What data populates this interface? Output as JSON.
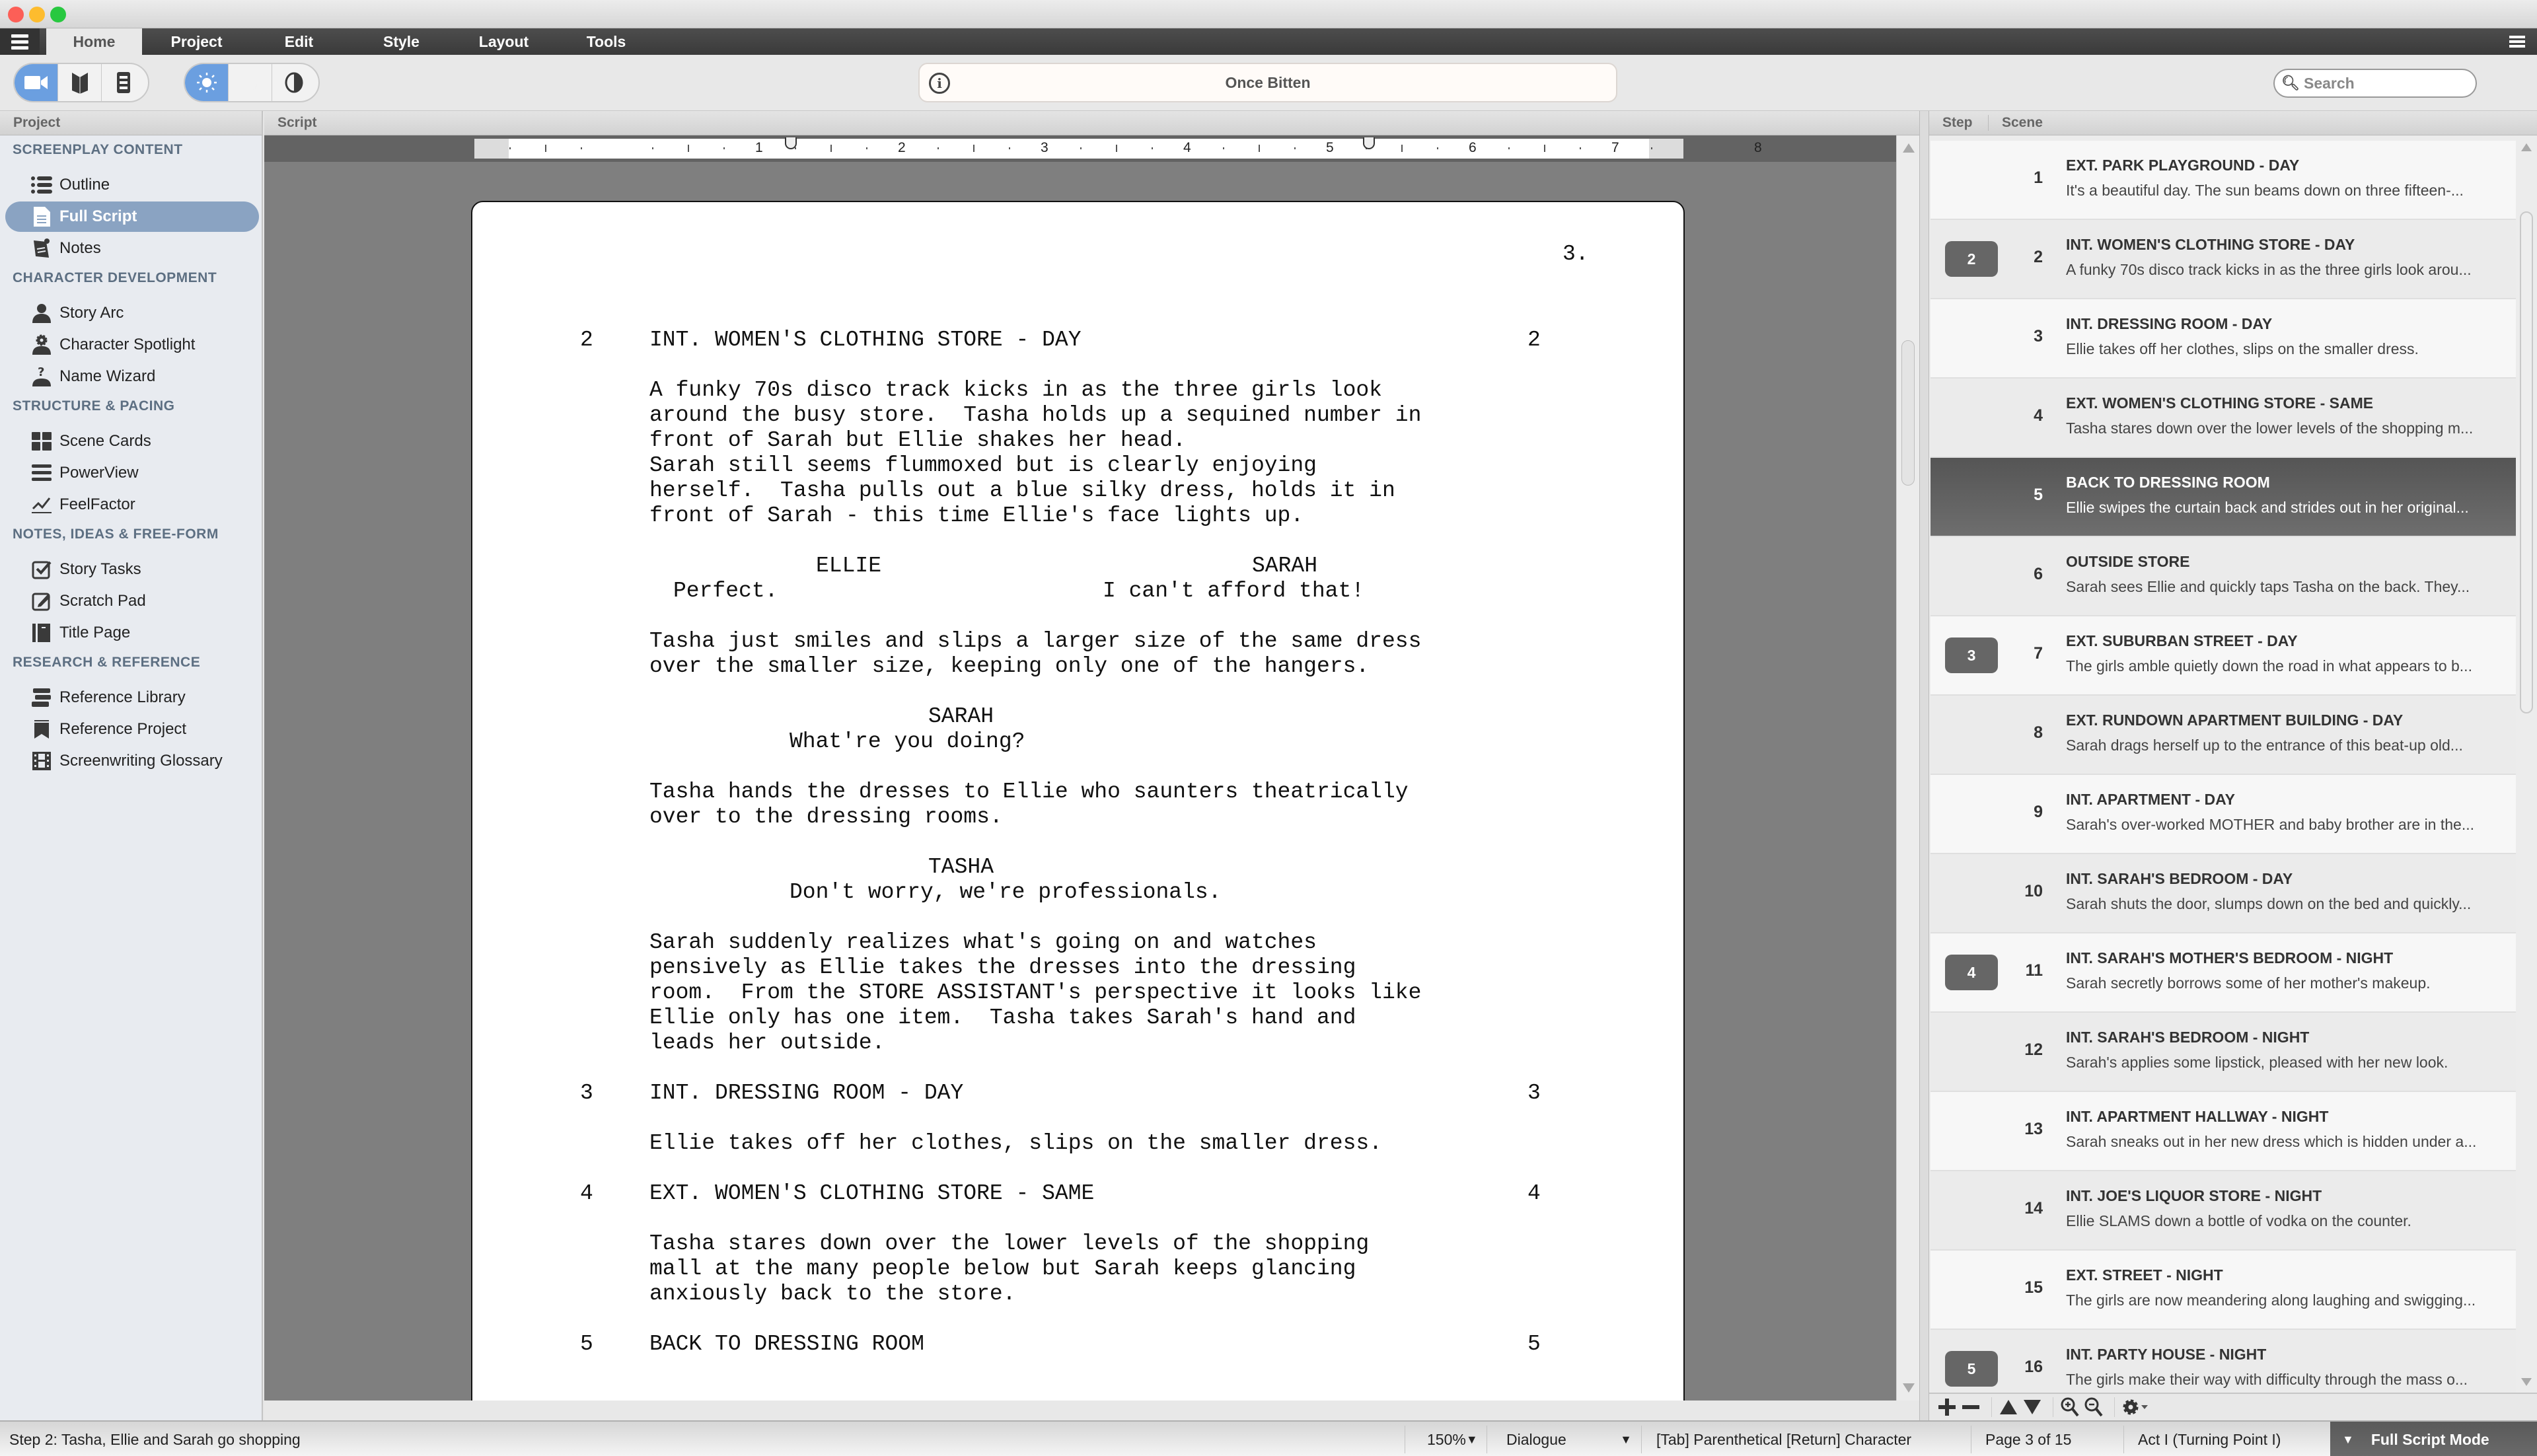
{
  "window": {
    "title": "Once Bitten"
  },
  "ribbon": {
    "tabs": [
      {
        "label": "Home",
        "active": true
      },
      {
        "label": "Project",
        "active": false
      },
      {
        "label": "Edit",
        "active": false
      },
      {
        "label": "Style",
        "active": false
      },
      {
        "label": "Layout",
        "active": false
      },
      {
        "label": "Tools",
        "active": false
      }
    ]
  },
  "toolbar": {
    "view_modes": [
      "video-camera-icon",
      "book-icon",
      "index-cards-icon"
    ],
    "active_view_mode": "video-camera-icon",
    "themes": [
      "sun-icon",
      "moon-icon",
      "contrast-icon"
    ],
    "active_theme": "sun-icon",
    "project_title": "Once Bitten",
    "search_placeholder": "Search",
    "accent_color": "#6b9fe0"
  },
  "panels": {
    "project_header": "Project",
    "script_header": "Script",
    "step_header": "Step",
    "scene_header": "Scene"
  },
  "sidebar": {
    "sections": [
      {
        "title": "SCREENPLAY CONTENT",
        "items": [
          {
            "label": "Outline",
            "icon": "list-icon"
          },
          {
            "label": "Full Script",
            "icon": "document-icon",
            "selected": true
          },
          {
            "label": "Notes",
            "icon": "notes-icon"
          }
        ]
      },
      {
        "title": "CHARACTER DEVELOPMENT",
        "items": [
          {
            "label": "Story Arc",
            "icon": "person-icon"
          },
          {
            "label": "Character Spotlight",
            "icon": "person-gear-icon"
          },
          {
            "label": "Name Wizard",
            "icon": "person-question-icon"
          }
        ]
      },
      {
        "title": "STRUCTURE & PACING",
        "items": [
          {
            "label": "Scene Cards",
            "icon": "grid-icon"
          },
          {
            "label": "PowerView",
            "icon": "rows-icon"
          },
          {
            "label": "FeelFactor",
            "icon": "line-chart-icon"
          }
        ]
      },
      {
        "title": "NOTES, IDEAS & FREE-FORM",
        "items": [
          {
            "label": "Story Tasks",
            "icon": "checkbox-icon"
          },
          {
            "label": "Scratch Pad",
            "icon": "edit-icon"
          },
          {
            "label": "Title Page",
            "icon": "title-page-icon"
          }
        ]
      },
      {
        "title": "RESEARCH & REFERENCE",
        "items": [
          {
            "label": "Reference Library",
            "icon": "books-icon"
          },
          {
            "label": "Reference Project",
            "icon": "bookmark-icon"
          },
          {
            "label": "Screenwriting Glossary",
            "icon": "film-icon"
          }
        ]
      }
    ]
  },
  "ruler": {
    "labels": [
      "1",
      "2",
      "3",
      "4",
      "5",
      "6",
      "7",
      "8"
    ]
  },
  "script": {
    "page_number": "3.",
    "lines": [
      {
        "kind": "scene_number_left",
        "text": "2"
      },
      {
        "kind": "heading",
        "text": "INT. WOMEN'S CLOTHING STORE - DAY"
      },
      {
        "kind": "scene_number_right",
        "text": "2"
      },
      {
        "kind": "action",
        "text": "A funky 70s disco track kicks in as the three girls look"
      },
      {
        "kind": "action",
        "text": "around the busy store.  Tasha holds up a sequined number in"
      },
      {
        "kind": "action",
        "text": "front of Sarah but Ellie shakes her head."
      },
      {
        "kind": "action",
        "text": "Sarah still seems flummoxed but is clearly enjoying"
      },
      {
        "kind": "action",
        "text": "herself.  Tasha pulls out a blue silky dress, holds it in"
      },
      {
        "kind": "action",
        "text": "front of Sarah - this time Ellie's face lights up."
      },
      {
        "kind": "character",
        "text": "ELLIE"
      },
      {
        "kind": "character",
        "text": "SARAH"
      },
      {
        "kind": "dialogue",
        "text": "Perfect."
      },
      {
        "kind": "dialogue",
        "text": "I can't afford that!"
      },
      {
        "kind": "action",
        "text": "Tasha just smiles and slips a larger size of the same dress"
      },
      {
        "kind": "action",
        "text": "over the smaller size, keeping only one of the hangers."
      },
      {
        "kind": "character",
        "text": "SARAH"
      },
      {
        "kind": "dialogue",
        "text": "What're you doing?"
      },
      {
        "kind": "action",
        "text": "Tasha hands the dresses to Ellie who saunters theatrically"
      },
      {
        "kind": "action",
        "text": "over to the dressing rooms."
      },
      {
        "kind": "character",
        "text": "TASHA"
      },
      {
        "kind": "dialogue",
        "text": "Don't worry, we're professionals."
      },
      {
        "kind": "action",
        "text": "Sarah suddenly realizes what's going on and watches"
      },
      {
        "kind": "action",
        "text": "pensively as Ellie takes the dresses into the dressing"
      },
      {
        "kind": "action",
        "text": "room.  From the STORE ASSISTANT's perspective it looks like"
      },
      {
        "kind": "action",
        "text": "Ellie only has one item.  Tasha takes Sarah's hand and"
      },
      {
        "kind": "action",
        "text": "leads her outside."
      },
      {
        "kind": "scene_number_left",
        "text": "3"
      },
      {
        "kind": "heading",
        "text": "INT. DRESSING ROOM - DAY"
      },
      {
        "kind": "scene_number_right",
        "text": "3"
      },
      {
        "kind": "action",
        "text": "Ellie takes off her clothes, slips on the smaller dress."
      },
      {
        "kind": "scene_number_left",
        "text": "4"
      },
      {
        "kind": "heading",
        "text": "EXT. WOMEN'S CLOTHING STORE - SAME"
      },
      {
        "kind": "scene_number_right",
        "text": "4"
      },
      {
        "kind": "action",
        "text": "Tasha stares down over the lower levels of the shopping"
      },
      {
        "kind": "action",
        "text": "mall at the many people below but Sarah keeps glancing"
      },
      {
        "kind": "action",
        "text": "anxiously back to the store."
      },
      {
        "kind": "scene_number_left",
        "text": "5"
      },
      {
        "kind": "heading",
        "text": "BACK TO DRESSING ROOM"
      },
      {
        "kind": "scene_number_right",
        "text": "5"
      }
    ]
  },
  "scenes": [
    {
      "step": "",
      "num": "1",
      "title": "EXT. PARK PLAYGROUND - DAY",
      "desc": "It's a beautiful day.  The sun beams down on three fifteen-..."
    },
    {
      "step": "2",
      "num": "2",
      "title": "INT. WOMEN'S CLOTHING STORE - DAY",
      "desc": "A funky 70s disco track kicks in as the three girls look arou..."
    },
    {
      "step": "",
      "num": "3",
      "title": "INT. DRESSING ROOM - DAY",
      "desc": "Ellie takes off her clothes, slips on the smaller dress."
    },
    {
      "step": "",
      "num": "4",
      "title": "EXT. WOMEN'S CLOTHING STORE - SAME",
      "desc": "Tasha stares down over the lower levels of the shopping m..."
    },
    {
      "step": "",
      "num": "5",
      "title": "BACK TO DRESSING ROOM",
      "desc": "Ellie swipes the curtain back and strides out in her original...",
      "selected": true
    },
    {
      "step": "",
      "num": "6",
      "title": "OUTSIDE STORE",
      "desc": "Sarah sees Ellie and quickly taps Tasha on the back.  They..."
    },
    {
      "step": "3",
      "num": "7",
      "title": "EXT. SUBURBAN STREET - DAY",
      "desc": "The girls amble quietly down the road in what appears to b..."
    },
    {
      "step": "",
      "num": "8",
      "title": "EXT. RUNDOWN APARTMENT BUILDING - DAY",
      "desc": "Sarah drags herself up to the entrance of this beat-up old..."
    },
    {
      "step": "",
      "num": "9",
      "title": "INT. APARTMENT - DAY",
      "desc": "Sarah's over-worked MOTHER and baby brother are in the..."
    },
    {
      "step": "",
      "num": "10",
      "title": "INT. SARAH'S BEDROOM - DAY",
      "desc": "Sarah shuts the door, slumps down on the bed and quickly..."
    },
    {
      "step": "4",
      "num": "11",
      "title": "INT. SARAH'S MOTHER'S BEDROOM - NIGHT",
      "desc": "Sarah secretly borrows some of her mother's makeup."
    },
    {
      "step": "",
      "num": "12",
      "title": "INT. SARAH'S BEDROOM - NIGHT",
      "desc": "Sarah's applies some lipstick, pleased with her new look."
    },
    {
      "step": "",
      "num": "13",
      "title": "INT. APARTMENT HALLWAY - NIGHT",
      "desc": "Sarah sneaks out in her new dress which is hidden under a..."
    },
    {
      "step": "",
      "num": "14",
      "title": "INT. JOE'S LIQUOR STORE - NIGHT",
      "desc": "Ellie SLAMS down a bottle of vodka on the counter."
    },
    {
      "step": "",
      "num": "15",
      "title": "EXT. STREET - NIGHT",
      "desc": "The girls are now meandering along laughing and swigging..."
    },
    {
      "step": "5",
      "num": "16",
      "title": "INT. PARTY HOUSE - NIGHT",
      "desc": "The girls make their way with difficulty through the mass o..."
    }
  ],
  "scene_toolbar": {
    "buttons": [
      "add-icon",
      "remove-icon",
      "move-up-icon",
      "move-down-icon",
      "zoom-in-icon",
      "zoom-out-icon",
      "gear-icon"
    ]
  },
  "statusbar": {
    "step_text": "Step 2:  Tasha, Ellie and Sarah go shopping",
    "zoom": "150%",
    "element_style": "Dialogue",
    "shortcuts": "[Tab] Parenthetical  [Return] Character",
    "page": "Page 3 of 15",
    "act": "Act I (Turning Point I)",
    "mode": "Full Script Mode"
  }
}
